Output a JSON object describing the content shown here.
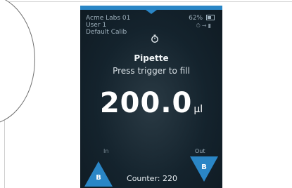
{
  "header": {
    "lab_name": "Acme Labs 01",
    "user": "User 1",
    "calibration": "Default Calib",
    "battery": "62%"
  },
  "icons": {
    "timer": "stopwatch-icon",
    "status": "status-icons",
    "battery": "battery-icon"
  },
  "main": {
    "mode": "Pipette",
    "prompt": "Press trigger to fill",
    "volume_value": "200.0",
    "volume_unit": "µl"
  },
  "controls": {
    "in_label": "In",
    "in_button_letter": "B",
    "out_label": "Out",
    "out_button_letter": "B",
    "counter": "Counter: 220"
  },
  "colors": {
    "accent": "#2a86c6",
    "screen_bg": "#14232d",
    "dial_green": "#7fbf41"
  }
}
